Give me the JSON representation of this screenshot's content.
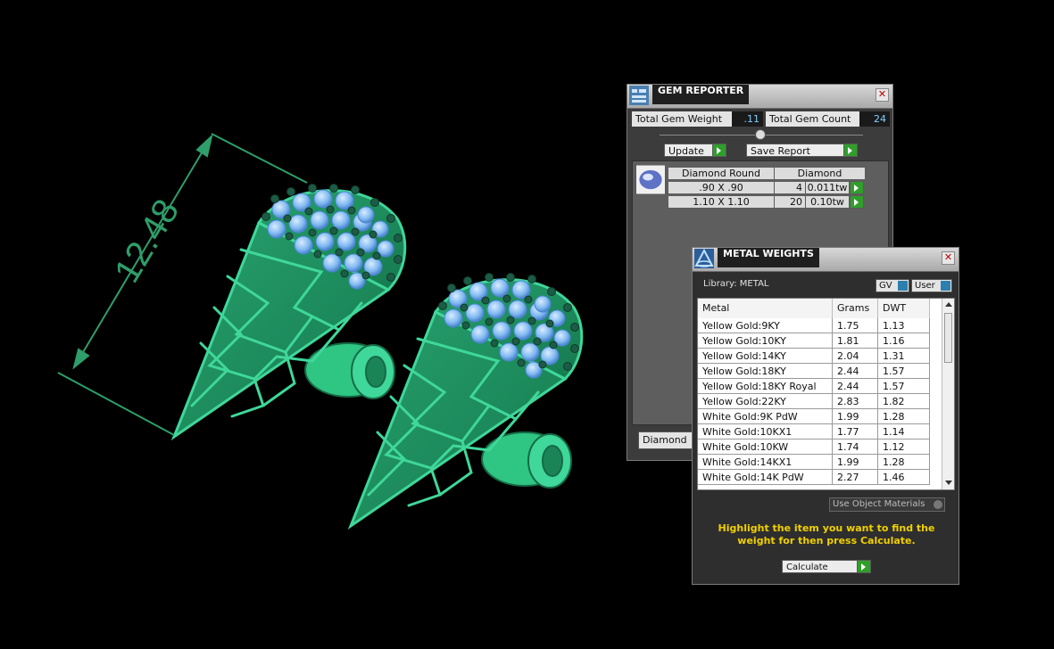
{
  "viewport": {
    "dimension_value": "12.48",
    "colors": {
      "model_body": "#1f8a5e",
      "model_edge": "#3fd79a",
      "stones": "#7fb8f0",
      "prongs": "#1c5c46",
      "dimension_line": "#2e9e6a"
    }
  },
  "gem_reporter": {
    "title": "GEM REPORTER",
    "total_weight_label": "Total Gem Weight",
    "total_weight_value": ".11",
    "total_count_label": "Total Gem Count",
    "total_count_value": "24",
    "update_label": "Update",
    "save_report_label": "Save Report",
    "table": {
      "header": [
        "Diamond Round",
        "Diamond"
      ],
      "rows": [
        {
          "size": ".90 X .90",
          "count": "4",
          "weight": "0.011tw"
        },
        {
          "size": "1.10 X 1.10",
          "count": "20",
          "weight": "0.10tw"
        }
      ]
    },
    "material_dropdown": "Diamond"
  },
  "metal_weights": {
    "title": "METAL WEIGHTS",
    "library_label": "Library: METAL",
    "gv_label": "GV",
    "user_label": "User",
    "columns": [
      "Metal",
      "Grams",
      "DWT"
    ],
    "rows": [
      {
        "metal": "Yellow Gold:9KY",
        "grams": "1.75",
        "dwt": "1.13"
      },
      {
        "metal": "Yellow Gold:10KY",
        "grams": "1.81",
        "dwt": "1.16"
      },
      {
        "metal": "Yellow Gold:14KY",
        "grams": "2.04",
        "dwt": "1.31"
      },
      {
        "metal": "Yellow Gold:18KY",
        "grams": "2.44",
        "dwt": "1.57"
      },
      {
        "metal": "Yellow Gold:18KY Royal",
        "grams": "2.44",
        "dwt": "1.57"
      },
      {
        "metal": "Yellow Gold:22KY",
        "grams": "2.83",
        "dwt": "1.82"
      },
      {
        "metal": "White Gold:9K PdW",
        "grams": "1.99",
        "dwt": "1.28"
      },
      {
        "metal": "White Gold:10KX1",
        "grams": "1.77",
        "dwt": "1.14"
      },
      {
        "metal": "White Gold:10KW",
        "grams": "1.74",
        "dwt": "1.12"
      },
      {
        "metal": "White Gold:14KX1",
        "grams": "1.99",
        "dwt": "1.28"
      },
      {
        "metal": "White Gold:14K PdW",
        "grams": "2.27",
        "dwt": "1.46"
      }
    ],
    "use_object_materials_label": "Use Object Materials",
    "instruction": "Highlight the item you want to find the weight for then press Calculate.",
    "calculate_label": "Calculate",
    "colors": {
      "instruction_text": "#f0d000",
      "accent_green": "#2f9e2a"
    }
  }
}
